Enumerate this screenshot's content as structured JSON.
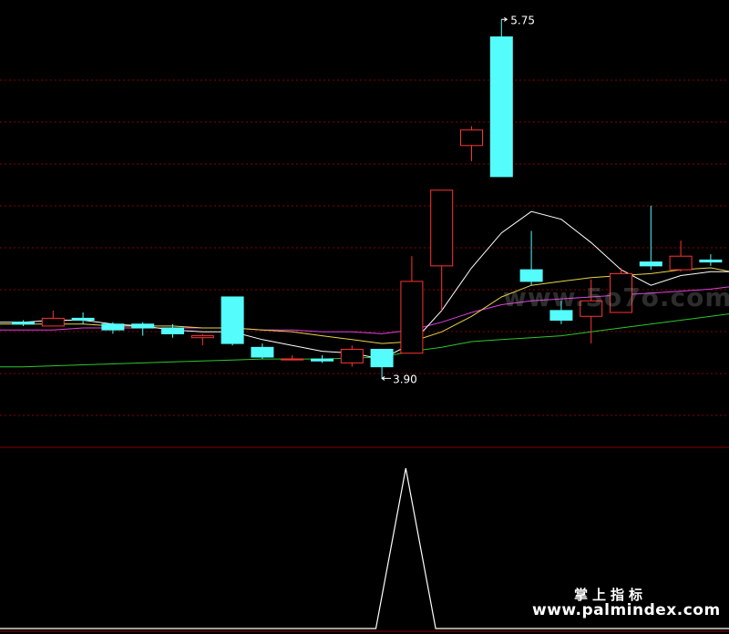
{
  "chart_data": {
    "type": "candlestick",
    "background": "#000000",
    "colors": {
      "up": "#ff3232",
      "down": "#54fcfc",
      "ma5": "#ffffff",
      "ma10": "#e8d44a",
      "ma20": "#e040e0",
      "ma60": "#2ec62e",
      "indicator": "#ffffff",
      "grid": "#8b0000",
      "annotation": "#ffffff"
    },
    "price_range": [
      3.55,
      5.85
    ],
    "candles": [
      {
        "o": 4.19,
        "h": 4.2,
        "l": 4.17,
        "c": 4.18
      },
      {
        "o": 4.17,
        "h": 4.25,
        "l": 4.17,
        "c": 4.21
      },
      {
        "o": 4.21,
        "h": 4.24,
        "l": 4.18,
        "c": 4.2
      },
      {
        "o": 4.18,
        "h": 4.19,
        "l": 4.13,
        "c": 4.15
      },
      {
        "o": 4.18,
        "h": 4.19,
        "l": 4.12,
        "c": 4.16
      },
      {
        "o": 4.16,
        "h": 4.18,
        "l": 4.11,
        "c": 4.13
      },
      {
        "o": 4.11,
        "h": 4.13,
        "l": 4.07,
        "c": 4.12
      },
      {
        "o": 4.32,
        "h": 4.32,
        "l": 4.07,
        "c": 4.08
      },
      {
        "o": 4.06,
        "h": 4.08,
        "l": 4.0,
        "c": 4.01
      },
      {
        "o": 4.0,
        "h": 4.02,
        "l": 4.0,
        "c": 4.0
      },
      {
        "o": 4.0,
        "h": 4.02,
        "l": 3.98,
        "c": 3.99
      },
      {
        "o": 3.98,
        "h": 4.07,
        "l": 3.96,
        "c": 4.05
      },
      {
        "o": 4.05,
        "h": 4.05,
        "l": 3.9,
        "c": 3.96
      },
      {
        "o": 4.03,
        "h": 4.53,
        "l": 4.03,
        "c": 4.4
      },
      {
        "o": 4.48,
        "h": 4.87,
        "l": 4.25,
        "c": 4.87
      },
      {
        "o": 5.1,
        "h": 5.2,
        "l": 5.02,
        "c": 5.18
      },
      {
        "o": 5.66,
        "h": 5.75,
        "l": 4.94,
        "c": 4.94
      },
      {
        "o": 4.46,
        "h": 4.66,
        "l": 4.38,
        "c": 4.4
      },
      {
        "o": 4.25,
        "h": 4.3,
        "l": 4.18,
        "c": 4.2
      },
      {
        "o": 4.22,
        "h": 4.41,
        "l": 4.08,
        "c": 4.3
      },
      {
        "o": 4.24,
        "h": 4.47,
        "l": 4.24,
        "c": 4.44
      },
      {
        "o": 4.5,
        "h": 4.79,
        "l": 4.46,
        "c": 4.48
      },
      {
        "o": 4.46,
        "h": 4.61,
        "l": 4.45,
        "c": 4.53
      },
      {
        "o": 4.51,
        "h": 4.54,
        "l": 4.48,
        "c": 4.5
      },
      {
        "o": 4.5,
        "h": 4.51,
        "l": 4.43,
        "c": 4.43
      }
    ],
    "ma5": [
      4.19,
      4.2,
      4.2,
      4.18,
      4.17,
      4.15,
      4.14,
      4.14,
      4.1,
      4.07,
      4.04,
      4.03,
      4.0,
      4.08,
      4.25,
      4.47,
      4.65,
      4.76,
      4.72,
      4.6,
      4.46,
      4.38,
      4.43,
      4.45,
      4.45
    ],
    "ma10": [
      4.18,
      4.18,
      4.18,
      4.17,
      4.17,
      4.17,
      4.16,
      4.16,
      4.15,
      4.14,
      4.12,
      4.1,
      4.08,
      4.09,
      4.14,
      4.22,
      4.32,
      4.38,
      4.4,
      4.42,
      4.43,
      4.44,
      4.46,
      4.47,
      4.44
    ],
    "ma20": [
      4.15,
      4.15,
      4.16,
      4.16,
      4.16,
      4.16,
      4.16,
      4.16,
      4.15,
      4.15,
      4.14,
      4.14,
      4.13,
      4.15,
      4.19,
      4.24,
      4.28,
      4.3,
      4.31,
      4.32,
      4.33,
      4.34,
      4.35,
      4.36,
      4.38
    ],
    "ma60": [
      3.96,
      3.965,
      3.97,
      3.975,
      3.98,
      3.985,
      3.99,
      3.995,
      4.0,
      4.0,
      4.0,
      4.005,
      4.01,
      4.04,
      4.06,
      4.09,
      4.1,
      4.11,
      4.12,
      4.14,
      4.16,
      4.18,
      4.2,
      4.22,
      4.24
    ],
    "indicator": {
      "x": [
        0,
        11.8,
        12.8,
        13.8,
        25
      ],
      "y": [
        0,
        0,
        1,
        0,
        0
      ]
    },
    "annotations": {
      "high": "5.75",
      "low": "3.90"
    }
  },
  "watermark": {
    "cn": "掌上指标",
    "url": "www.palmindex.com",
    "faint": "www.5o7o.com"
  }
}
